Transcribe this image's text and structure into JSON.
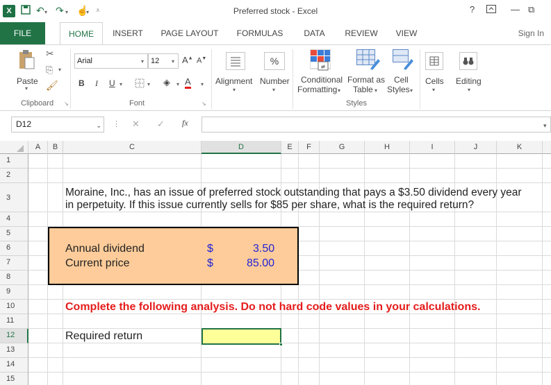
{
  "app": {
    "window_title": "Preferred stock - Excel",
    "help": "?",
    "minimize": "—",
    "restore": "⧉"
  },
  "tabs": [
    "FILE",
    "HOME",
    "INSERT",
    "PAGE LAYOUT",
    "FORMULAS",
    "DATA",
    "REVIEW",
    "VIEW"
  ],
  "active_tab": "HOME",
  "signin": "Sign In",
  "ribbon": {
    "paste": "Paste",
    "clipboard": "Clipboard",
    "font_name": "Arial",
    "font_size": "12",
    "bold": "B",
    "italic": "I",
    "underline": "U",
    "font_group": "Font",
    "alignment": "Alignment",
    "number": "Number",
    "number_icon": "%",
    "cond_fmt_1": "Conditional",
    "cond_fmt_2": "Formatting",
    "format_table_1": "Format as",
    "format_table_2": "Table",
    "cell_styles_1": "Cell",
    "cell_styles_2": "Styles",
    "styles_group": "Styles",
    "cells": "Cells",
    "editing": "Editing"
  },
  "formula_bar": {
    "name_box": "D12",
    "fx": "fx",
    "value": ""
  },
  "columns": [
    "A",
    "B",
    "C",
    "D",
    "E",
    "F",
    "G",
    "H",
    "I",
    "J",
    "K"
  ],
  "selected_column": "D",
  "rows": [
    "1",
    "2",
    "3",
    "4",
    "5",
    "6",
    "7",
    "8",
    "9",
    "10",
    "11",
    "12",
    "13",
    "14",
    "15"
  ],
  "selected_row": "12",
  "sheet": {
    "question_line1": "Moraine, Inc., has an issue of preferred stock outstanding that pays a $3.50 dividend every year",
    "question_line2": "in perpetuity. If this issue currently sells for $85 per share, what is the required return?",
    "dividend_label": "Annual dividend",
    "dividend_currency": "$",
    "dividend_value": "3.50",
    "price_label": "Current price",
    "price_currency": "$",
    "price_value": "85.00",
    "instruction": "Complete the following analysis. Do not hard code values in your calculations.",
    "required_return_label": "Required return",
    "required_return_value": ""
  },
  "colors": {
    "excel_green": "#217346",
    "input_box": "#fdcc9a",
    "input_text": "#2222d4",
    "instruction_text": "#e51c1c",
    "answer_cell": "#ffff99"
  }
}
